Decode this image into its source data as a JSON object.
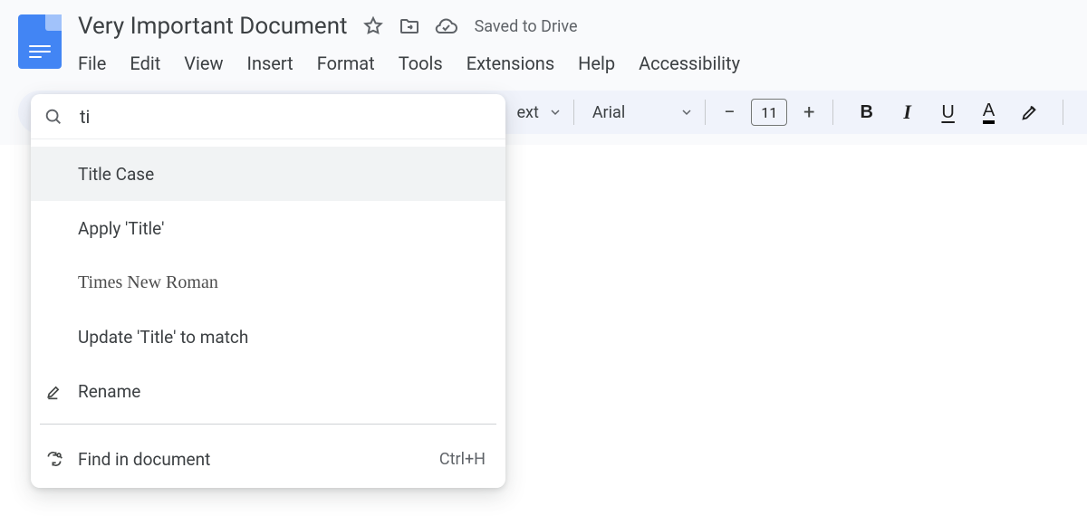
{
  "header": {
    "doc_title": "Very Important Document",
    "saved_status": "Saved to Drive"
  },
  "menubar": [
    "File",
    "Edit",
    "View",
    "Insert",
    "Format",
    "Tools",
    "Extensions",
    "Help",
    "Accessibility"
  ],
  "toolbar": {
    "styles_partial": "ext",
    "font_name": "Arial",
    "font_size": "11",
    "bold": "B",
    "italic": "I",
    "underline": "U",
    "text_color": "A"
  },
  "search": {
    "query": "ti",
    "items": [
      {
        "label": "Title Case",
        "highlight": true
      },
      {
        "label": "Apply 'Title'"
      },
      {
        "label": "Times New Roman",
        "serif": true
      },
      {
        "label": "Update 'Title' to match"
      },
      {
        "label": "Rename",
        "icon": "rename"
      }
    ],
    "footer": {
      "label": "Find in document",
      "shortcut": "Ctrl+H",
      "icon": "find"
    }
  }
}
